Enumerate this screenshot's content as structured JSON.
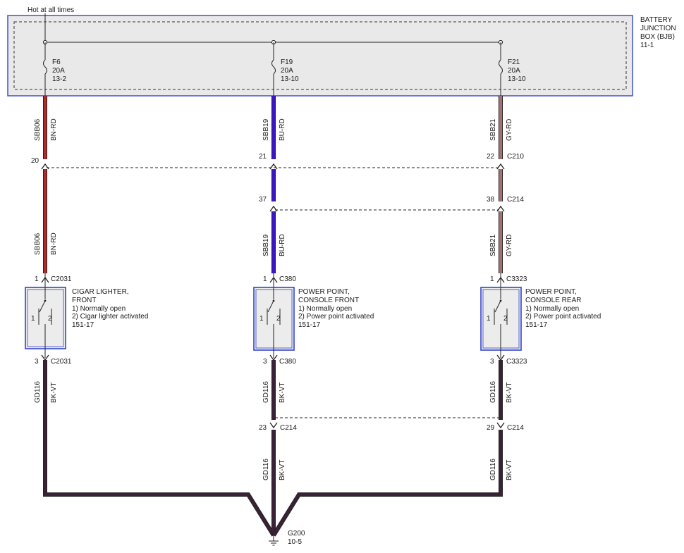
{
  "header": {
    "hot_label": "Hot at all times"
  },
  "bjb": {
    "lines": [
      "BATTERY",
      "JUNCTION",
      "BOX (BJB)",
      "11-1"
    ]
  },
  "fuses": [
    {
      "name": "F6",
      "rating": "20A",
      "ref": "13-2"
    },
    {
      "name": "F19",
      "rating": "20A",
      "ref": "13-10"
    },
    {
      "name": "F21",
      "rating": "20A",
      "ref": "13-10"
    }
  ],
  "wires": {
    "c1_top": {
      "circuit": "SBB06",
      "color": "BN-RD"
    },
    "c1_mid": {
      "circuit": "SBB06",
      "color": "BN-RD"
    },
    "c2_top": {
      "circuit": "SBB19",
      "color": "BU-RD"
    },
    "c2_mid": {
      "circuit": "SBB19",
      "color": "BU-RD"
    },
    "c3_top": {
      "circuit": "SBB21",
      "color": "GY-RD"
    },
    "c3_mid": {
      "circuit": "SBB21",
      "color": "GY-RD"
    },
    "c1_bot": {
      "circuit": "GD116",
      "color": "BK-VT"
    },
    "c2_bot": {
      "circuit": "GD116",
      "color": "BK-VT"
    },
    "c2_low": {
      "circuit": "GD116",
      "color": "BK-VT"
    },
    "c3_bot": {
      "circuit": "GD116",
      "color": "BK-VT"
    },
    "c3_low": {
      "circuit": "GD116",
      "color": "BK-VT"
    }
  },
  "connectors": {
    "c210": {
      "name": "C210",
      "pins": [
        "20",
        "21",
        "22"
      ]
    },
    "c214_top": {
      "name": "C214",
      "pins": [
        "37",
        "38"
      ]
    },
    "c214_bot": {
      "name": "C214",
      "pins": [
        "23",
        "29"
      ]
    },
    "c2031_top": {
      "name": "C2031",
      "pin": "1"
    },
    "c380_top": {
      "name": "C380",
      "pin": "1"
    },
    "c3323_top": {
      "name": "C3323",
      "pin": "1"
    },
    "c2031_bot": {
      "name": "C2031",
      "pin": "3"
    },
    "c380_bot": {
      "name": "C380",
      "pin": "3"
    },
    "c3323_bot": {
      "name": "C3323",
      "pin": "3"
    }
  },
  "components": [
    {
      "title1": "CIGAR LIGHTER,",
      "title2": "FRONT",
      "note1": "1) Normally open",
      "note2": "2) Cigar lighter activated",
      "ref": "151-17",
      "pin_a": "1",
      "pin_b": "2"
    },
    {
      "title1": "POWER POINT,",
      "title2": "CONSOLE FRONT",
      "note1": "1) Normally open",
      "note2": "2) Power point activated",
      "ref": "151-17",
      "pin_a": "1",
      "pin_b": "2"
    },
    {
      "title1": "POWER POINT,",
      "title2": "CONSOLE REAR",
      "note1": "1) Normally open",
      "note2": "2) Power point activated",
      "ref": "151-17",
      "pin_a": "1",
      "pin_b": "2"
    }
  ],
  "ground": {
    "name": "G200",
    "ref": "10-5"
  },
  "colors": {
    "bn_rd": "#b32a2a",
    "bu_rd": "#3b16c2",
    "gy_rd": "#a87070",
    "bk_vt": "#3a2236",
    "box_border": "#3344cc",
    "box_fill": "#ebebeb"
  }
}
